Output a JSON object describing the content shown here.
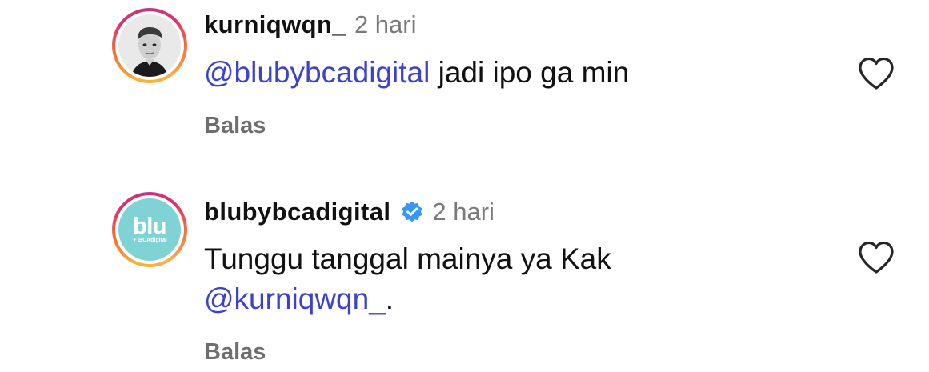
{
  "comments": [
    {
      "avatar": "profile-photo",
      "username": "kurniqwqn_",
      "time": "2 hari",
      "verified": false,
      "mention": "@blubybcadigital",
      "text": " jadi ipo ga min",
      "reply_label": "Balas",
      "like_icon": "heart-outline-icon"
    },
    {
      "avatar": "blu-logo",
      "avatar_logo_text": "blu",
      "avatar_logo_sub": "✦ BCAdigital",
      "avatar_bg": "#7fd3d4",
      "username": "blubybcadigital",
      "time": "2 hari",
      "verified": true,
      "verified_color": "#3897f0",
      "text_line1": "Tunggu tanggal mainya ya Kak",
      "mention": "@kurniqwqn_",
      "text_after_mention": ".",
      "reply_label": "Balas",
      "like_icon": "heart-outline-icon"
    }
  ],
  "colors": {
    "mention": "#3d43c9",
    "meta_gray": "#7a7a7a",
    "reply_gray": "#6e6e6e",
    "text": "#111111"
  }
}
